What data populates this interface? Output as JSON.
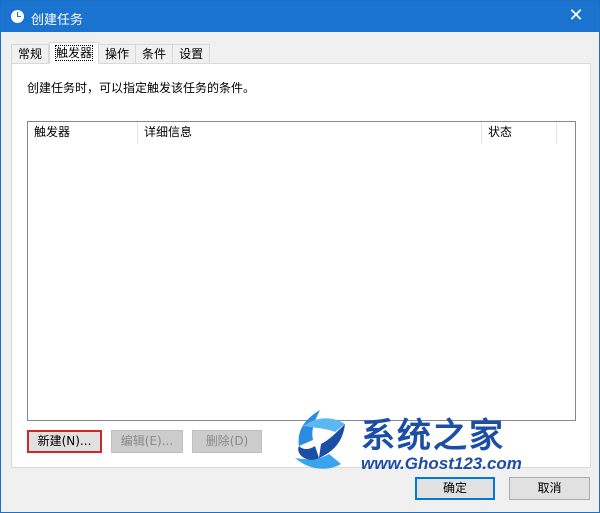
{
  "window": {
    "title": "创建任务",
    "close_glyph": "✕"
  },
  "tabs": [
    {
      "label": "常规"
    },
    {
      "label": "触发器",
      "active": true
    },
    {
      "label": "操作"
    },
    {
      "label": "条件"
    },
    {
      "label": "设置"
    }
  ],
  "panel": {
    "description": "创建任务时，可以指定触发该任务的条件。",
    "columns": [
      "触发器",
      "详细信息",
      "状态"
    ],
    "rows": []
  },
  "buttons": {
    "new": "新建(N)...",
    "edit": "编辑(E)...",
    "delete": "删除(D)",
    "ok": "确定",
    "cancel": "取消"
  },
  "watermark": {
    "title": "系统之家",
    "url": "www.Ghost123.com"
  },
  "colors": {
    "titlebar": "#1a73cf",
    "highlight_border": "#cc2a2a",
    "watermark": "#1c4ea6"
  }
}
